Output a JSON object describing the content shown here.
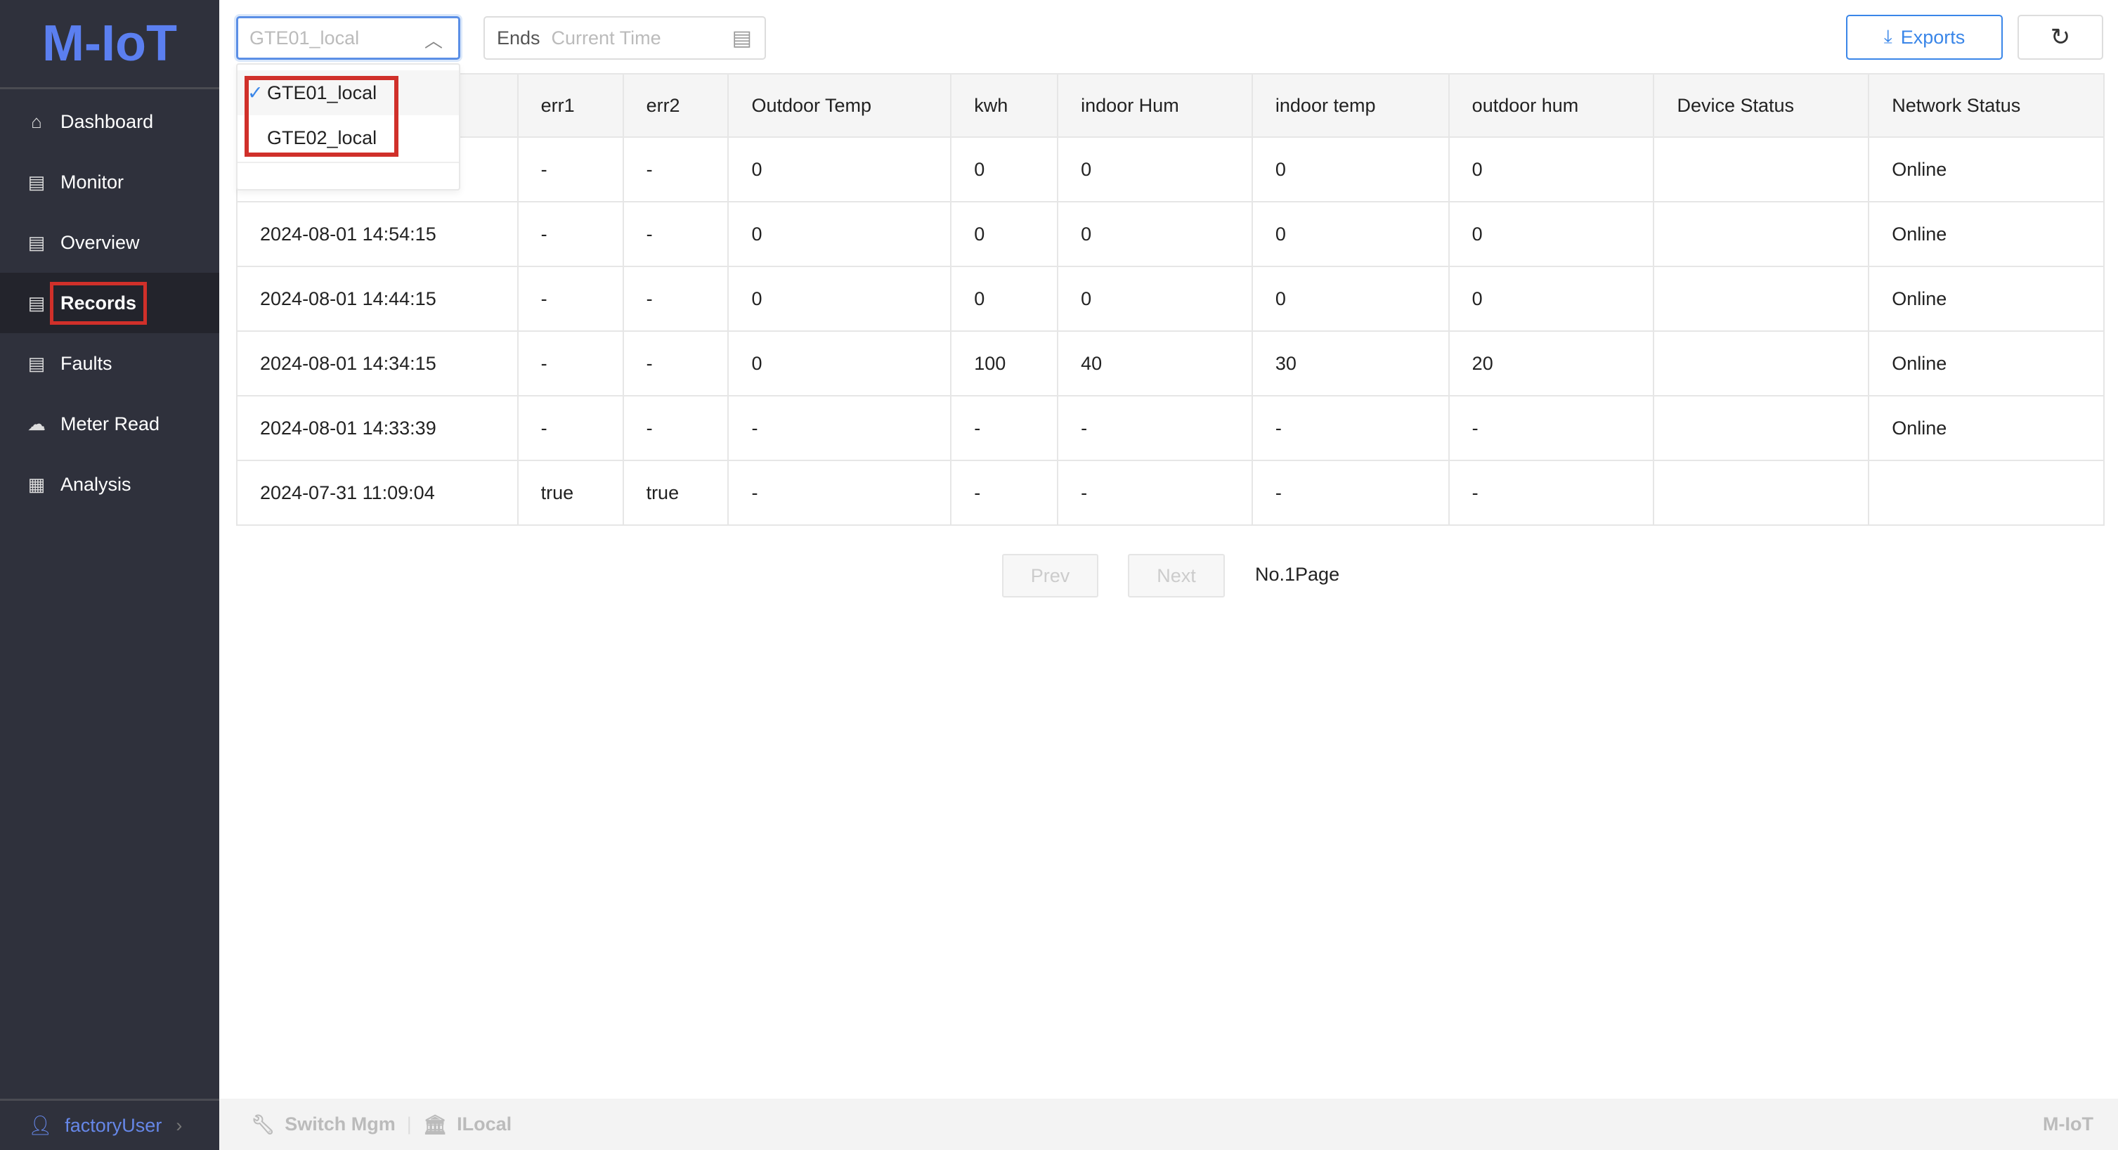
{
  "app": {
    "logo": "M-IoT"
  },
  "sidebar": {
    "items": [
      {
        "label": "Dashboard",
        "icon": "home-icon"
      },
      {
        "label": "Monitor",
        "icon": "list-icon"
      },
      {
        "label": "Overview",
        "icon": "list-icon"
      },
      {
        "label": "Records",
        "icon": "document-icon",
        "active": true
      },
      {
        "label": "Faults",
        "icon": "document-icon"
      },
      {
        "label": "Meter Read",
        "icon": "cloud-download-icon"
      },
      {
        "label": "Analysis",
        "icon": "grid-icon"
      }
    ],
    "user": "factoryUser"
  },
  "toolbar": {
    "device_value": "GTE01_local",
    "ends_label": "Ends",
    "ends_placeholder": "Current Time",
    "exports": "Exports"
  },
  "dropdown": {
    "options": [
      "GTE01_local",
      "GTE02_local"
    ],
    "selected": "GTE01_local"
  },
  "table": {
    "headers": [
      "",
      "err1",
      "err2",
      "Outdoor Temp",
      "kwh",
      "indoor Hum",
      "indoor temp",
      "outdoor hum",
      "Device Status",
      "Network Status"
    ],
    "rows": [
      [
        "",
        "-",
        "-",
        "0",
        "0",
        "0",
        "0",
        "0",
        "",
        "Online"
      ],
      [
        "2024-08-01 14:54:15",
        "-",
        "-",
        "0",
        "0",
        "0",
        "0",
        "0",
        "",
        "Online"
      ],
      [
        "2024-08-01 14:44:15",
        "-",
        "-",
        "0",
        "0",
        "0",
        "0",
        "0",
        "",
        "Online"
      ],
      [
        "2024-08-01 14:34:15",
        "-",
        "-",
        "0",
        "100",
        "40",
        "30",
        "20",
        "",
        "Online"
      ],
      [
        "2024-08-01 14:33:39",
        "-",
        "-",
        "-",
        "-",
        "-",
        "-",
        "-",
        "",
        "Online"
      ],
      [
        "2024-07-31 11:09:04",
        "true",
        "true",
        "-",
        "-",
        "-",
        "-",
        "-",
        "",
        ""
      ]
    ]
  },
  "pagination": {
    "prev": "Prev",
    "next": "Next",
    "page": "No.1Page"
  },
  "footer": {
    "switch": "Switch Mgm",
    "local": "ILocal",
    "brand": "M-IoT"
  },
  "colors": {
    "accent": "#3a86e8",
    "sidebar": "#2f313c",
    "highlight": "#d0302a"
  }
}
